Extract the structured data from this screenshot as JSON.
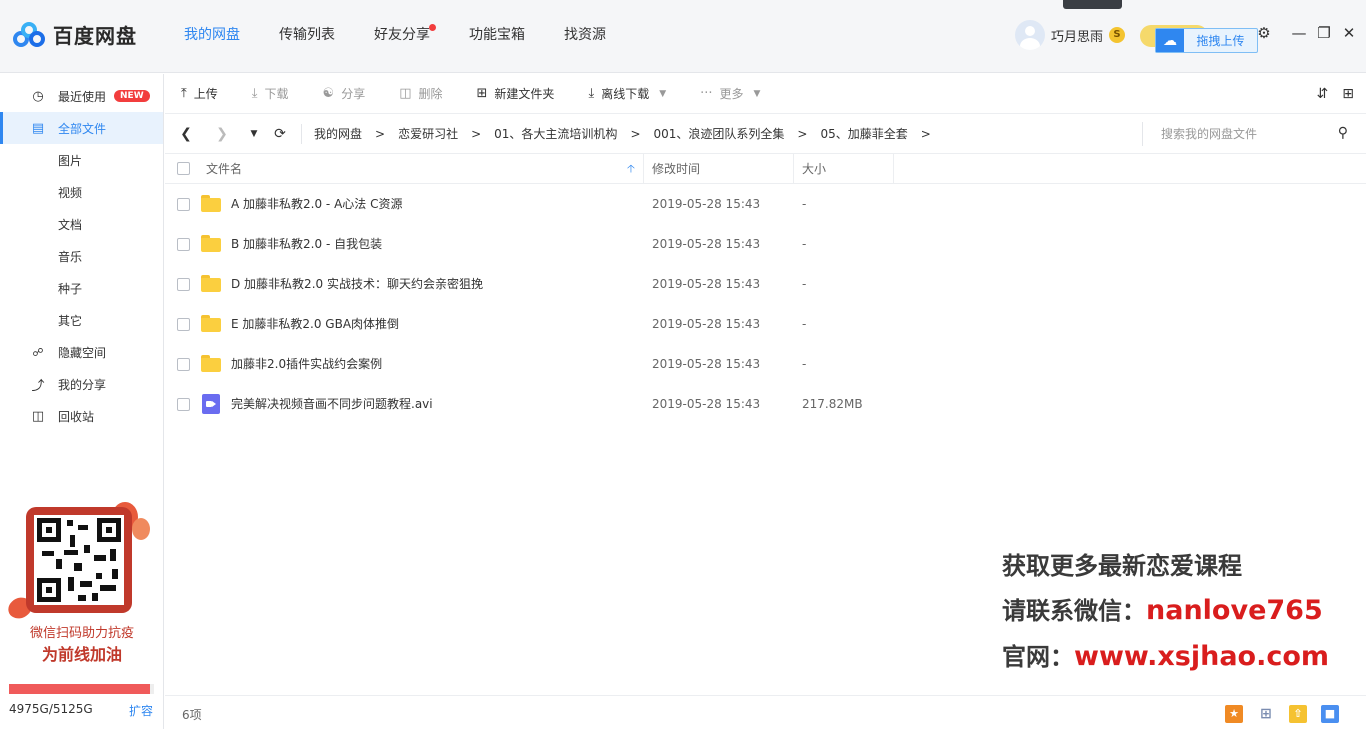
{
  "app": {
    "name": "百度网盘",
    "nav": [
      {
        "label": "我的网盘",
        "active": true
      },
      {
        "label": "传输列表",
        "active": false
      },
      {
        "label": "好友分享",
        "active": false,
        "dot": true
      },
      {
        "label": "功能宝箱",
        "active": false
      },
      {
        "label": "找资源",
        "active": false
      }
    ],
    "user": {
      "name": "巧月思雨",
      "badge": "S"
    },
    "drag_upload_label": "拖拽上传",
    "controls": {
      "settings": "⚙",
      "minimize": "—",
      "restore": "❐",
      "close": "✕"
    }
  },
  "sidebar": {
    "items": [
      {
        "label": "最近使用",
        "icon": "clock-icon",
        "glyph": "◷",
        "badge": "NEW"
      },
      {
        "label": "全部文件",
        "icon": "document-icon",
        "glyph": "▤",
        "active": true
      },
      {
        "label": "图片",
        "sub": true
      },
      {
        "label": "视频",
        "sub": true
      },
      {
        "label": "文档",
        "sub": true
      },
      {
        "label": "音乐",
        "sub": true
      },
      {
        "label": "种子",
        "sub": true
      },
      {
        "label": "其它",
        "sub": true
      },
      {
        "label": "隐藏空间",
        "icon": "lock-icon",
        "glyph": "🔒"
      },
      {
        "label": "我的分享",
        "icon": "share-icon",
        "glyph": "⋲"
      },
      {
        "label": "回收站",
        "icon": "trash-icon",
        "glyph": "🗑"
      }
    ],
    "promo": {
      "line1": "微信扫码助力抗疫",
      "line2": "为前线加油"
    },
    "quota": {
      "text": "4975G/5125G",
      "used_fraction": 0.971,
      "expand_label": "扩容"
    }
  },
  "toolbar": {
    "buttons": [
      {
        "label": "上传",
        "glyph": "⤒",
        "icon": "upload-icon",
        "enabled": true
      },
      {
        "label": "下载",
        "glyph": "⤓",
        "icon": "download-icon",
        "enabled": false
      },
      {
        "label": "分享",
        "glyph": "⋲",
        "icon": "share-icon",
        "enabled": false
      },
      {
        "label": "删除",
        "glyph": "🗑",
        "icon": "trash-icon",
        "enabled": false
      },
      {
        "label": "新建文件夹",
        "glyph": "⊞",
        "icon": "new-folder-icon",
        "enabled": true
      },
      {
        "label": "离线下载",
        "glyph": "⤓",
        "icon": "offline-download-icon",
        "enabled": true,
        "caret": true
      },
      {
        "label": "更多",
        "glyph": "···",
        "icon": "more-icon",
        "enabled": false,
        "caret": true
      }
    ]
  },
  "breadcrumb": {
    "items": [
      "我的网盘",
      "恋爱研习社",
      "01、各大主流培训机构",
      "001、浪迹团队系列全集",
      "05、加藤菲全套"
    ],
    "search_placeholder": "搜索我的网盘文件"
  },
  "list": {
    "columns": {
      "name": "文件名",
      "modified": "修改时间",
      "size": "大小"
    },
    "rows": [
      {
        "name": "A 加藤非私教2.0 - A心法 C资源",
        "date": "2019-05-28 15:43",
        "size": "-",
        "type": "folder"
      },
      {
        "name": "B 加藤非私教2.0 - 自我包装",
        "date": "2019-05-28 15:43",
        "size": "-",
        "type": "folder"
      },
      {
        "name": "D 加藤非私教2.0 实战技术：聊天约会亲密狙挽",
        "date": "2019-05-28 15:43",
        "size": "-",
        "type": "folder"
      },
      {
        "name": "E 加藤非私教2.0 GBA肉体推倒",
        "date": "2019-05-28 15:43",
        "size": "-",
        "type": "folder"
      },
      {
        "name": "加藤非2.0插件实战约会案例",
        "date": "2019-05-28 15:43",
        "size": "-",
        "type": "folder"
      },
      {
        "name": "完美解决视频音画不同步问题教程.avi",
        "date": "2019-05-28 15:43",
        "size": "217.82MB",
        "type": "video"
      }
    ],
    "count_label": "6项"
  },
  "watermark": {
    "line1": "获取更多最新恋爱课程",
    "line2_prefix": "请联系微信：",
    "line2_value": "nanlove765",
    "line3_prefix": "官网：",
    "line3_value": "www.xsjhao.com"
  },
  "colors": {
    "accent": "#2f87f0",
    "badge_red": "#f23d3d",
    "folder": "#fbcf3f",
    "video": "#6a6cf0",
    "quota": "#f05a5a"
  }
}
